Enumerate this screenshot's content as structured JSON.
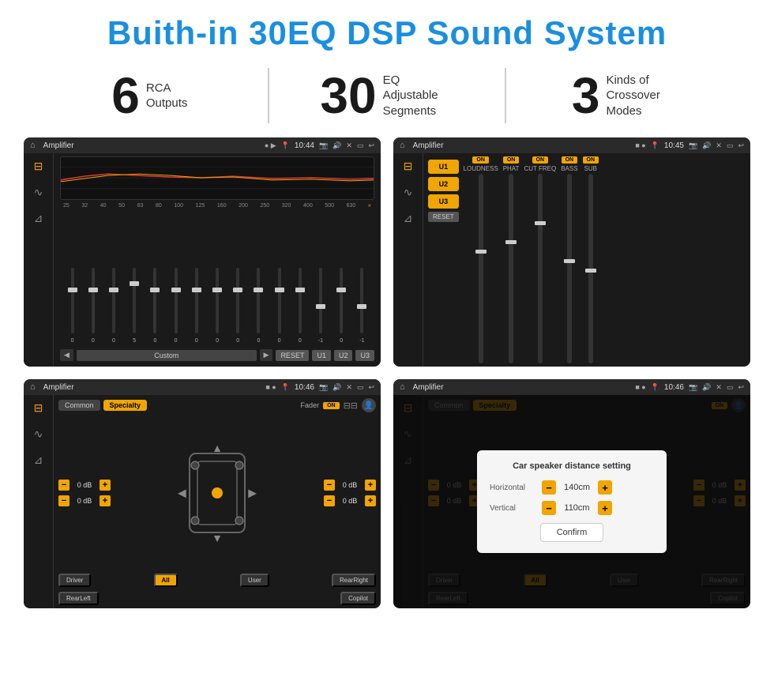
{
  "header": {
    "title": "Buith-in 30EQ DSP Sound System"
  },
  "stats": [
    {
      "number": "6",
      "label": "RCA\nOutputs"
    },
    {
      "number": "30",
      "label": "EQ Adjustable\nSegments"
    },
    {
      "number": "3",
      "label": "Kinds of\nCrossover Modes"
    }
  ],
  "screens": {
    "eq": {
      "title": "Amplifier",
      "time": "10:44",
      "freqs": [
        "25",
        "32",
        "40",
        "50",
        "63",
        "80",
        "100",
        "125",
        "160",
        "200",
        "250",
        "320",
        "400",
        "500",
        "630"
      ],
      "values": [
        "0",
        "0",
        "0",
        "5",
        "0",
        "0",
        "0",
        "0",
        "0",
        "0",
        "0",
        "0",
        "-1",
        "0",
        "-1"
      ],
      "presets": [
        "Custom",
        "RESET",
        "U1",
        "U2",
        "U3"
      ]
    },
    "crossover": {
      "title": "Amplifier",
      "time": "10:45",
      "presets": [
        "U1",
        "U2",
        "U3"
      ],
      "channels": [
        {
          "on": true,
          "label": "LOUDNESS"
        },
        {
          "on": true,
          "label": "PHAT"
        },
        {
          "on": true,
          "label": "CUT FREQ"
        },
        {
          "on": true,
          "label": "BASS"
        },
        {
          "on": true,
          "label": "SUB"
        }
      ],
      "reset": "RESET"
    },
    "fader": {
      "title": "Amplifier",
      "time": "10:46",
      "tabs": [
        "Common",
        "Specialty"
      ],
      "activeTab": "Specialty",
      "faderLabel": "Fader",
      "faderOn": "ON",
      "volumes": [
        "0 dB",
        "0 dB",
        "0 dB",
        "0 dB"
      ],
      "footerBtns": [
        "Driver",
        "All",
        "User",
        "RearRight",
        "RearLeft",
        "Copilot"
      ]
    },
    "dialog": {
      "title": "Amplifier",
      "time": "10:46",
      "tabs": [
        "Common",
        "Specialty"
      ],
      "dialogTitle": "Car speaker distance setting",
      "horizontal": {
        "label": "Horizontal",
        "value": "140cm"
      },
      "vertical": {
        "label": "Vertical",
        "value": "110cm"
      },
      "confirmBtn": "Confirm",
      "footerBtns": [
        "Driver",
        "All",
        "User",
        "RearRight",
        "RearLeft",
        "Copilot"
      ]
    }
  }
}
